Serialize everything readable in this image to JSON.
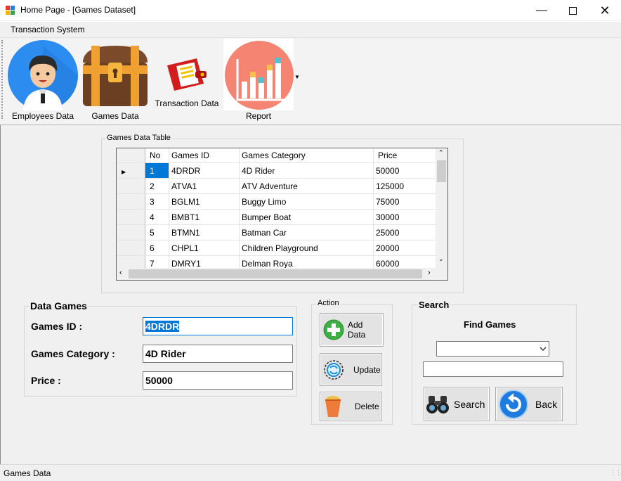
{
  "window": {
    "title": "Home Page - [Games Dataset]"
  },
  "menu": {
    "item": "Transaction System"
  },
  "toolbar": {
    "employees_label": "Employees Data",
    "games_label": "Games Data",
    "transaction_label": "Transaction Data",
    "report_label": "Report"
  },
  "grid": {
    "title": "Games Data Table",
    "columns": [
      "No",
      "Games ID",
      "Games Category",
      "Price"
    ],
    "rows": [
      [
        "1",
        "4DRDR",
        "4D Rider",
        "50000"
      ],
      [
        "2",
        "ATVA1",
        "ATV Adventure",
        "125000"
      ],
      [
        "3",
        "BGLM1",
        "Buggy Limo",
        "75000"
      ],
      [
        "4",
        "BMBT1",
        "Bumper Boat",
        "30000"
      ],
      [
        "5",
        "BTMN1",
        "Batman Car",
        "25000"
      ],
      [
        "6",
        "CHPL1",
        "Children Playground",
        "20000"
      ],
      [
        "7",
        "DMRY1",
        "Delman Roya",
        "60000"
      ]
    ]
  },
  "form": {
    "title": "Data Games",
    "games_id_label": "Games ID :",
    "games_id_value": "4DRDR",
    "category_label": "Games Category :",
    "category_value": "4D Rider",
    "price_label": "Price :",
    "price_value": "50000"
  },
  "action": {
    "title": "Action",
    "add_label": "Add Data",
    "update_label": "Update",
    "delete_label": "Delete"
  },
  "search": {
    "title": "Search",
    "find_label": "Find Games",
    "dropdown_value": "",
    "text_value": "",
    "search_label": "Search",
    "back_label": "Back"
  },
  "status": {
    "text": "Games Data"
  },
  "colors": {
    "selection": "#0078d7",
    "background": "#f0f0f0"
  }
}
